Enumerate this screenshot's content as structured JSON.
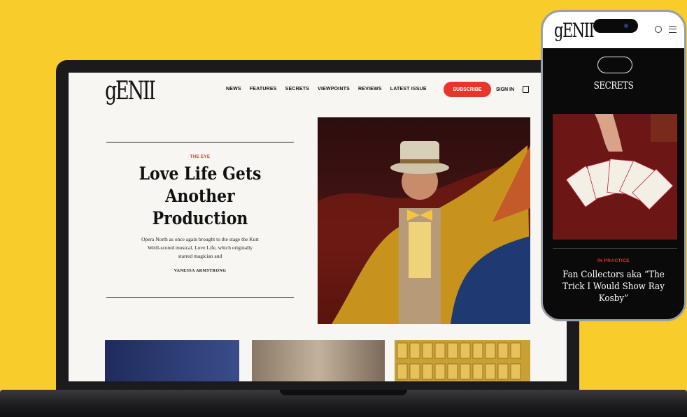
{
  "colors": {
    "background": "#f8cc2b",
    "accent": "#e8342a"
  },
  "site": {
    "logo": "gENII",
    "nav": [
      "NEWS",
      "FEATURES",
      "SECRETS",
      "VIEWPOINTS",
      "REVIEWS",
      "LATEST ISSUE"
    ],
    "subscribe_label": "SUBSCRIBE",
    "signin_label": "SIGN IN"
  },
  "hero": {
    "kicker": "THE EYE",
    "headline": "Love Life Gets Another Production",
    "dek": "Opera North as once again brought to the stage the Kurt Weill-scored musical, Love Life, which originally starred magician and",
    "byline": "VANESSA ARMSTRONG"
  },
  "phone": {
    "logo": "gENII",
    "section_title": "SECRETS",
    "kicker": "IN PRACTICE",
    "headline": "Fan Collectors aka “The Trick I Would Show Ray Kosby”"
  }
}
